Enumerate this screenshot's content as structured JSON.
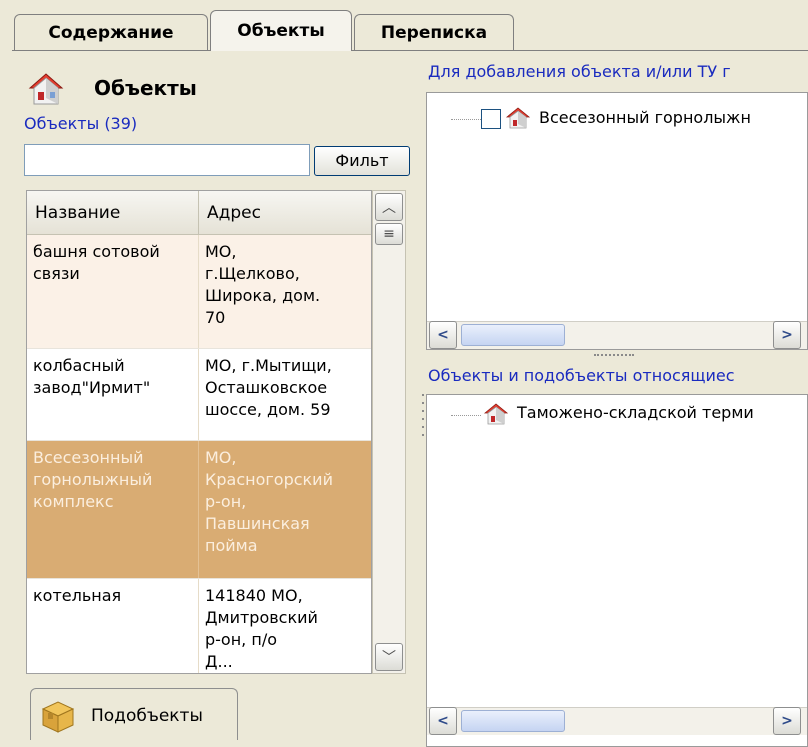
{
  "tabs": [
    {
      "label": "Содержание",
      "active": false
    },
    {
      "label": "Объекты",
      "active": true
    },
    {
      "label": "Переписка",
      "active": false
    }
  ],
  "left_panel": {
    "title": "Объекты",
    "count_link": "Объекты (39)",
    "filter": {
      "value": "",
      "button_label": "Фильт"
    },
    "columns": [
      "Название",
      "Адрес"
    ],
    "rows": [
      {
        "name": "башня сотовой\nсвязи",
        "address": "МО,\nг.Щелково,\nШирока, дом.\n70",
        "selected": false
      },
      {
        "name": "колбасный\nзавод\"Ирмит\"",
        "address": "МО, г.Мытищи,\nОсташковское\nшоссе, дом. 59",
        "selected": false
      },
      {
        "name": "Всесезонный\nгорнолыжный\nкомплекс",
        "address": "МО,\nКрасногорский\nр-он,\nПавшинская\nпойма",
        "selected": true
      },
      {
        "name": "котельная",
        "address": "141840 МО,\nДмитровский\nр-он, п/о\nД...",
        "selected": false
      }
    ],
    "subtab_label": "Подобъекты"
  },
  "right_top": {
    "header": "Для добавления объекта и/или ТУ г",
    "tree_items": [
      {
        "label": "Всесезонный горнолыжн",
        "checked": false
      }
    ]
  },
  "right_bottom": {
    "header": "Объекты и подобъекты относящиес",
    "tree_items": [
      {
        "label": "Таможено-складской терми"
      }
    ]
  },
  "icons": {
    "objects": "house-icon",
    "subobjects": "box-icon",
    "tree_item": "house-icon"
  },
  "colors": {
    "window_bg": "#ece9d8",
    "row_odd": "#fbf1e7",
    "row_even": "#ffffff",
    "row_selected": "#d9ac73",
    "link": "#1a2bbf"
  }
}
